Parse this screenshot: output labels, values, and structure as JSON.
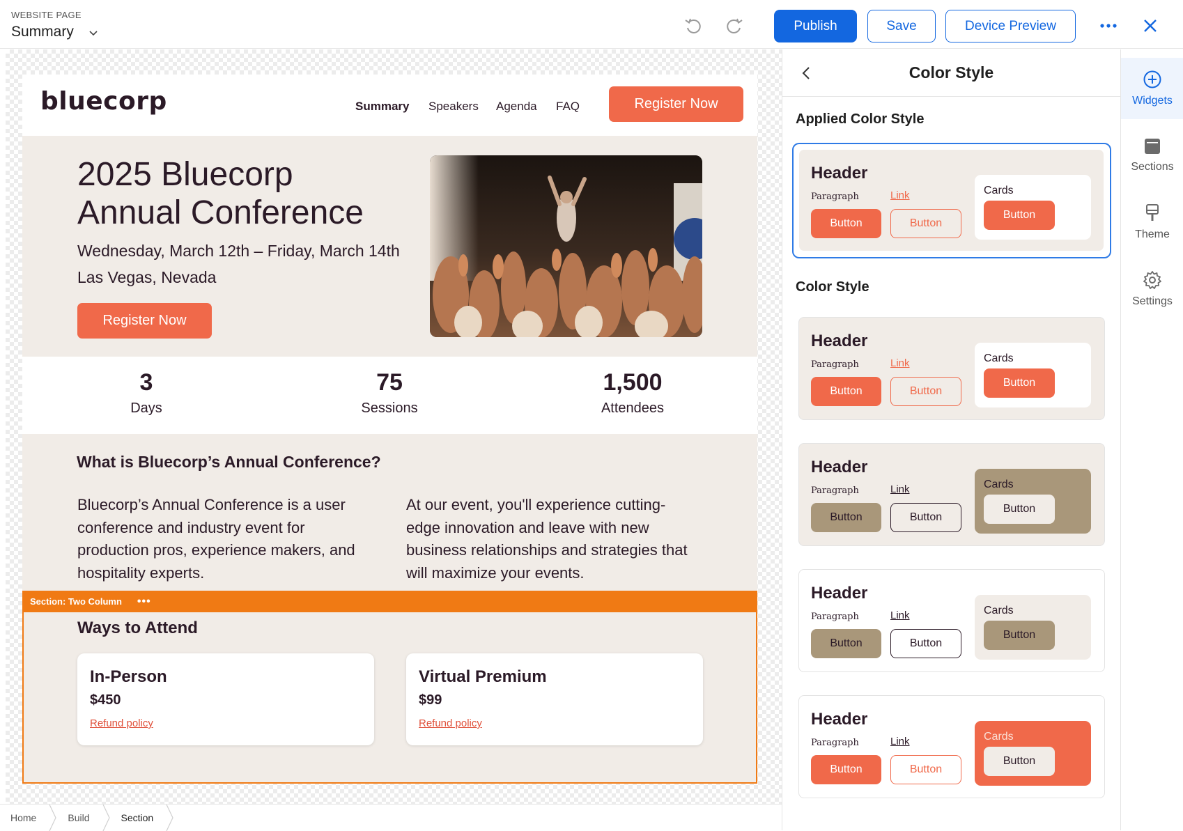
{
  "topbar": {
    "caption": "WEBSITE PAGE",
    "page": "Summary",
    "publish": "Publish",
    "save": "Save",
    "device_preview": "Device Preview"
  },
  "site": {
    "logo": "bluecorp",
    "nav": [
      "Summary",
      "Speakers",
      "Agenda",
      "FAQ"
    ],
    "register": "Register Now",
    "hero": {
      "title_line1": "2025 Bluecorp",
      "title_line2": "Annual Conference",
      "date": "Wednesday, March 12th – Friday, March 14th",
      "location": "Las Vegas, Nevada",
      "cta": "Register Now"
    },
    "stats": [
      {
        "num": "3",
        "label": "Days"
      },
      {
        "num": "75",
        "label": "Sessions"
      },
      {
        "num": "1,500",
        "label": "Attendees"
      }
    ],
    "about": {
      "heading": "What is Bluecorp’s Annual Conference?",
      "col1": "Bluecorp’s Annual Conference is a user conference and industry event for production pros, experience makers, and hospitality experts.",
      "col2": "At our event, you'll experience cutting-edge innovation and leave with new business relationships and strategies that will maximize your events."
    },
    "section": {
      "label": "Section: Two Column",
      "heading": "Ways to Attend",
      "tickets": [
        {
          "name": "In-Person",
          "price": "$450",
          "link": "Refund policy"
        },
        {
          "name": "Virtual Premium",
          "price": "$99",
          "link": "Refund policy"
        }
      ]
    }
  },
  "breadcrumbs": [
    "Home",
    "Build",
    "Section"
  ],
  "panel": {
    "title": "Color Style",
    "applied_heading": "Applied Color Style",
    "list_heading": "Color Style",
    "sample": {
      "header": "Header",
      "paragraph": "Paragraph",
      "link": "Link",
      "button": "Button",
      "cards": "Cards"
    }
  },
  "rail": [
    "Widgets",
    "Sections",
    "Theme",
    "Settings"
  ],
  "colors": {
    "brand_blue": "#1367e0",
    "coral": "#f0694a",
    "cream": "#f1ece7",
    "khaki": "#a9977a",
    "plum": "#2b1a27",
    "section_orange": "#f07a14"
  }
}
